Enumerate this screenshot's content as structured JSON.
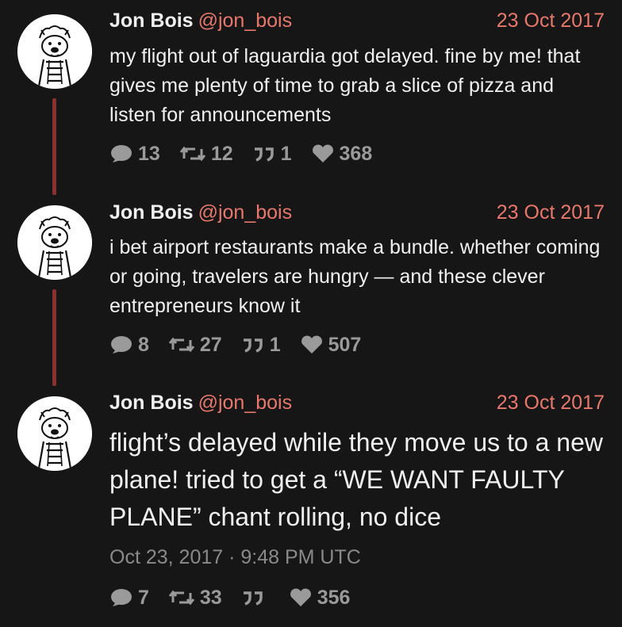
{
  "tweets": [
    {
      "author": "Jon Bois",
      "handle": "@jon_bois",
      "date": "23 Oct 2017",
      "text": "my flight out of laguardia got delayed. fine by me! that gives me plenty of time to grab a slice of pizza and listen for announcements",
      "stats": {
        "comments": "13",
        "retweets": "12",
        "quotes": "1",
        "likes": "368"
      }
    },
    {
      "author": "Jon Bois",
      "handle": "@jon_bois",
      "date": "23 Oct 2017",
      "text": "i bet airport restaurants make a bundle. whether coming or going, travelers are hungry — and these clever entrepreneurs know it",
      "stats": {
        "comments": "8",
        "retweets": "27",
        "quotes": "1",
        "likes": "507"
      }
    },
    {
      "author": "Jon Bois",
      "handle": "@jon_bois",
      "date": "23 Oct 2017",
      "text": "flight’s delayed while they move us to a new plane! tried to get a “WE WANT FAULTY PLANE” chant rolling, no dice",
      "published": "Oct 23, 2017 · 9:48 PM UTC",
      "stats": {
        "comments": "7",
        "retweets": "33",
        "quotes": "",
        "likes": "356"
      }
    }
  ],
  "colors": {
    "background": "#161616",
    "accent": "#e8776c",
    "thread_line": "#8b2f2f",
    "muted": "#9a9a9a"
  },
  "icons": [
    "avatar",
    "comment-icon",
    "retweet-icon",
    "quote-icon",
    "heart-icon"
  ]
}
